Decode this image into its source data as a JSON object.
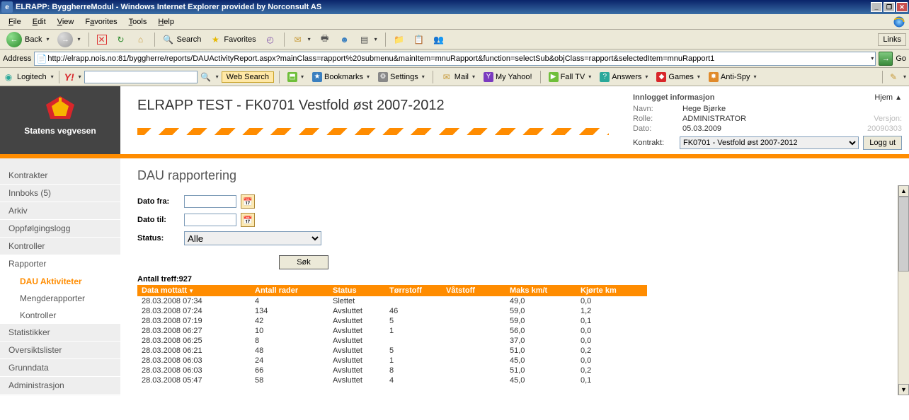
{
  "window": {
    "title": "ELRAPP: ByggherreModul - Windows Internet Explorer provided by Norconsult AS"
  },
  "menus": {
    "file": "File",
    "edit": "Edit",
    "view": "View",
    "favorites": "Favorites",
    "tools": "Tools",
    "help": "Help"
  },
  "toolbar1": {
    "back": "Back",
    "search": "Search",
    "favorites": "Favorites",
    "links": "Links"
  },
  "address": {
    "label": "Address",
    "url": "http://elrapp.nois.no:81/byggherre/reports/DAUActivityReport.aspx?mainClass=rapport%20submenu&mainItem=mnuRapport&function=selectSub&objClass=rapport&selectedItem=mnuRapport1",
    "go": "Go"
  },
  "ybar": {
    "logitech": "Logitech",
    "websearch": "Web Search",
    "bookmarks": "Bookmarks",
    "settings": "Settings",
    "mail": "Mail",
    "myyahoo": "My Yahoo!",
    "falltv": "Fall TV",
    "answers": "Answers",
    "games": "Games",
    "antispy": "Anti-Spy"
  },
  "brand": {
    "org": "Statens vegvesen"
  },
  "header": {
    "title": "ELRAPP TEST - FK0701 Vestfold øst 2007-2012"
  },
  "info": {
    "heading": "Innlogget informasjon",
    "home": "Hjem",
    "name_label": "Navn:",
    "name": "Hege Bjørke",
    "role_label": "Rolle:",
    "role": "ADMINISTRATOR",
    "date_label": "Dato:",
    "date": "05.03.2009",
    "version_label": "Versjon:",
    "version": "20090303",
    "kontrakt_label": "Kontrakt:",
    "kontrakt_selected": "FK0701 - Vestfold øst 2007-2012",
    "logout": "Logg ut"
  },
  "nav": {
    "items": {
      "kontrakter": "Kontrakter",
      "innboks": "Innboks (5)",
      "arkiv": "Arkiv",
      "oppfolgingslogg": "Oppfølgingslogg",
      "kontroller": "Kontroller",
      "rapporter": "Rapporter",
      "dau": "DAU Aktiviteter",
      "mengde": "Mengderapporter",
      "kontroller_sub": "Kontroller",
      "statistikker": "Statistikker",
      "oversiktslister": "Oversiktslister",
      "grunndata": "Grunndata",
      "administrasjon": "Administrasjon"
    }
  },
  "page": {
    "title": "DAU rapportering",
    "dato_fra": "Dato fra:",
    "dato_til": "Dato til:",
    "status_label": "Status:",
    "status_selected": "Alle",
    "sok": "Søk",
    "hits_label": "Antall treff:",
    "hits": "927"
  },
  "table": {
    "headers": {
      "mottatt": "Data mottatt",
      "rader": "Antall rader",
      "status": "Status",
      "torrstoff": "Tørrstoff",
      "vatstoff": "Våtstoff",
      "maks": "Maks km/t",
      "kjorte": "Kjørte km"
    },
    "rows": [
      {
        "mottatt": "28.03.2008 07:34",
        "rader": "4",
        "status": "Slettet",
        "torr": "",
        "vat": "",
        "maks": "49,0",
        "kjorte": "0,0"
      },
      {
        "mottatt": "28.03.2008 07:24",
        "rader": "134",
        "status": "Avsluttet",
        "torr": "46",
        "vat": "",
        "maks": "59,0",
        "kjorte": "1,2"
      },
      {
        "mottatt": "28.03.2008 07:19",
        "rader": "42",
        "status": "Avsluttet",
        "torr": "5",
        "vat": "",
        "maks": "59,0",
        "kjorte": "0,1"
      },
      {
        "mottatt": "28.03.2008 06:27",
        "rader": "10",
        "status": "Avsluttet",
        "torr": "1",
        "vat": "",
        "maks": "56,0",
        "kjorte": "0,0"
      },
      {
        "mottatt": "28.03.2008 06:25",
        "rader": "8",
        "status": "Avsluttet",
        "torr": "",
        "vat": "",
        "maks": "37,0",
        "kjorte": "0,0"
      },
      {
        "mottatt": "28.03.2008 06:21",
        "rader": "48",
        "status": "Avsluttet",
        "torr": "5",
        "vat": "",
        "maks": "51,0",
        "kjorte": "0,2"
      },
      {
        "mottatt": "28.03.2008 06:03",
        "rader": "24",
        "status": "Avsluttet",
        "torr": "1",
        "vat": "",
        "maks": "45,0",
        "kjorte": "0,0"
      },
      {
        "mottatt": "28.03.2008 06:03",
        "rader": "66",
        "status": "Avsluttet",
        "torr": "8",
        "vat": "",
        "maks": "51,0",
        "kjorte": "0,2"
      },
      {
        "mottatt": "28.03.2008 05:47",
        "rader": "58",
        "status": "Avsluttet",
        "torr": "4",
        "vat": "",
        "maks": "45,0",
        "kjorte": "0,1"
      }
    ]
  }
}
